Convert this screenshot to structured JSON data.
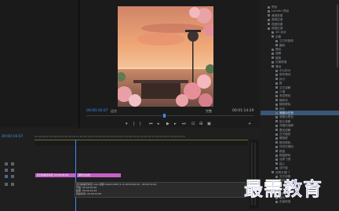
{
  "monitor": {
    "timecode_left": "00:00:16:07",
    "fit_label": "适合",
    "quality_label": "完整",
    "timecode_right": "00:01:14:29"
  },
  "transport": {
    "icons": [
      "marker-icon",
      "in-point-icon",
      "out-point-icon",
      "go-to-in-icon",
      "step-back-icon",
      "play-icon",
      "step-forward-icon",
      "go-to-out-icon",
      "lift-icon",
      "extract-icon",
      "export-frame-icon",
      "add-icon"
    ]
  },
  "effects_panel": {
    "items": [
      {
        "label": "预设",
        "indent": 1
      },
      {
        "label": "Lumetri 预设",
        "indent": 1
      },
      {
        "label": "音频效果",
        "indent": 1
      },
      {
        "label": "音频过渡",
        "indent": 1
      },
      {
        "label": "视频效果",
        "indent": 1
      },
      {
        "label": "视频过渡",
        "indent": 1
      },
      {
        "label": "3D 运动",
        "indent": 2
      },
      {
        "label": "划像",
        "indent": 2
      },
      {
        "label": "立方体旋转",
        "indent": 3
      },
      {
        "label": "翻转",
        "indent": 3
      },
      {
        "label": "擦除",
        "indent": 2
      },
      {
        "label": "溶解",
        "indent": 2
      },
      {
        "label": "缩放",
        "indent": 2
      },
      {
        "label": "页面剥落",
        "indent": 2
      },
      {
        "label": "滑动",
        "indent": 2
      },
      {
        "label": "中心拆分",
        "indent": 3
      },
      {
        "label": "带状滑动",
        "indent": 3
      },
      {
        "label": "拆分",
        "indent": 3
      },
      {
        "label": "推",
        "indent": 3
      },
      {
        "label": "交叉溶解",
        "indent": 3
      },
      {
        "label": "沙漠",
        "indent": 3
      },
      {
        "label": "渐变擦除",
        "indent": 3
      },
      {
        "label": "随机块",
        "indent": 3
      },
      {
        "label": "随机擦除",
        "indent": 3
      },
      {
        "label": "风车",
        "indent": 3
      },
      {
        "label": "渐隐为白色",
        "indent": 3,
        "selected": true
      },
      {
        "label": "渐隐为黑色",
        "indent": 3
      },
      {
        "label": "胶片溶解",
        "indent": 3
      },
      {
        "label": "非叠加溶解",
        "indent": 3
      },
      {
        "label": "叠加溶解",
        "indent": 3
      },
      {
        "label": "交叉缩放",
        "indent": 3
      },
      {
        "label": "螺旋框",
        "indent": 3
      },
      {
        "label": "楔形擦除",
        "indent": 3
      },
      {
        "label": "时钟式擦除",
        "indent": 3
      },
      {
        "label": "棋盘",
        "indent": 3
      },
      {
        "label": "棋盘擦除",
        "indent": 3
      },
      {
        "label": "油漆飞溅",
        "indent": 3
      },
      {
        "label": "插入",
        "indent": 3
      },
      {
        "label": "百叶窗",
        "indent": 3
      },
      {
        "label": "双侧平推门",
        "indent": 2
      },
      {
        "label": "交叉划像",
        "indent": 3
      },
      {
        "label": "圆划像",
        "indent": 3
      },
      {
        "label": "盒形划像",
        "indent": 3
      },
      {
        "label": "菱形划像",
        "indent": 3
      },
      {
        "label": "页面剥落",
        "indent": 2
      },
      {
        "label": "翻页",
        "indent": 3
      },
      {
        "label": "页面剥落",
        "indent": 3
      }
    ]
  },
  "timeline": {
    "timecode": "00:00:16:07",
    "ruler_label": "00:00:00:00   00:00:04:23   00:00:09:23   00:00:14:23   00:00:19:23   00:00:24:23   00:00:29:23   00:00:34:23   00:00:39:23   00:00:44:23",
    "clip1_label": "花卉新娘手捧花 00:00:00:00",
    "clip2_label": "渐隐为白色",
    "tooltip_line1": "花卉新娘手捧花.mp4 视频:1920x1080 (1.0) 00:00:00:00 - 00:00:14:24",
    "tooltip_line2": "开始: 00:00:00:00",
    "tooltip_line3": "结束: 00:00:14:24",
    "tooltip_line4": "持续时间: 00:00:15:00"
  },
  "watermark": "最需教育"
}
